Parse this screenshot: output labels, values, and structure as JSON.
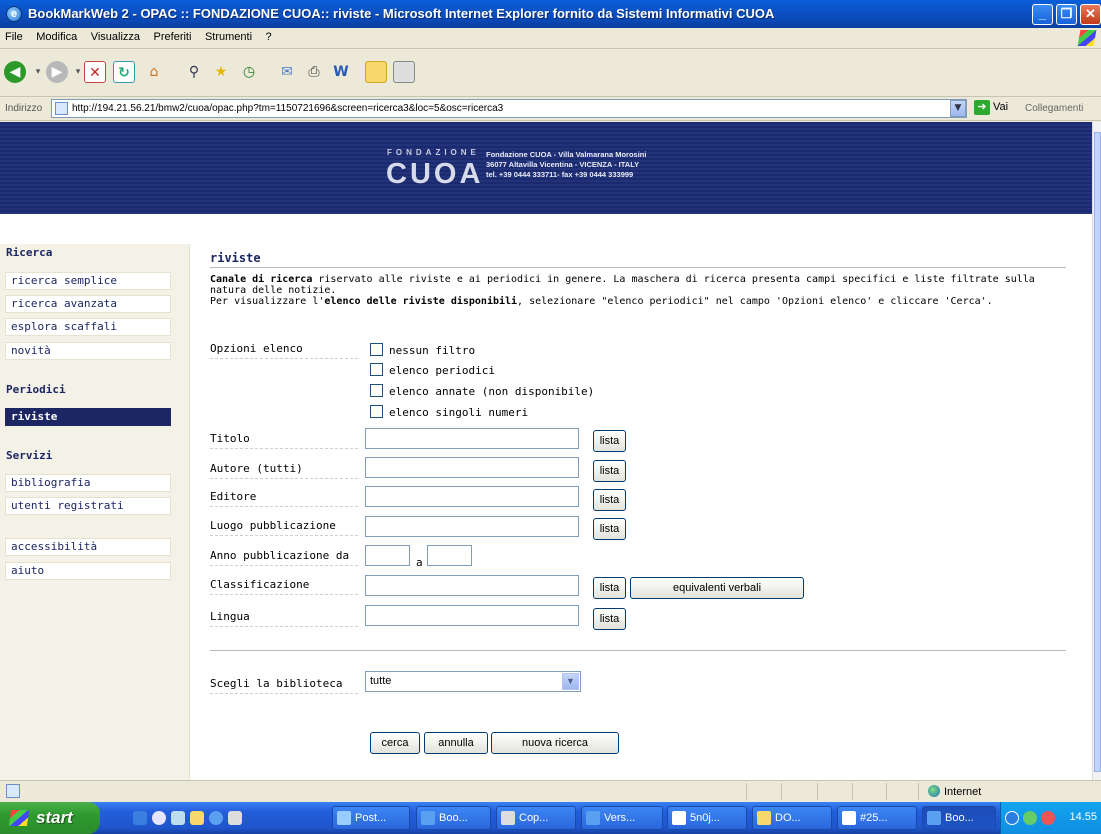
{
  "window": {
    "title": "BookMarkWeb 2 - OPAC :: FONDAZIONE CUOA:: riviste - Microsoft Internet Explorer fornito da Sistemi Informativi CUOA"
  },
  "menu": [
    "File",
    "Modifica",
    "Visualizza",
    "Preferiti",
    "Strumenti",
    "?"
  ],
  "address": {
    "label": "Indirizzo",
    "url": "http://194.21.56.21/bmw2/cuoa/opac.php?tm=1150721696&screen=ricerca3&loc=5&osc=ricerca3",
    "go": "Vai",
    "links": "Collegamenti"
  },
  "banner": {
    "fondazione": "FONDAZIONE",
    "cuoa": "CUOA",
    "line1": "Fondazione CUOA - Villa Valmarana Morosini",
    "line2": "36077 Altavilla Vicentina - VICENZA - ITALY",
    "line3": "tel. +39 0444 333711- fax +39 0444 333999"
  },
  "sidebar": {
    "ricerca_head": "Ricerca",
    "ricerca_items": [
      "ricerca semplice",
      "ricerca avanzata",
      "esplora scaffali",
      "novità"
    ],
    "periodici_head": "Periodici",
    "periodici_items": [
      "riviste"
    ],
    "servizi_head": "Servizi",
    "servizi_items": [
      "bibliografia",
      "utenti registrati"
    ],
    "extra_items": [
      "accessibilità",
      "aiuto"
    ]
  },
  "main": {
    "title": "riviste",
    "intro_bold1": "Canale di ricerca",
    "intro_text1": " riservato alle riviste e ai periodici in genere. La maschera di ricerca presenta campi specifici e liste filtrate sulla natura delle notizie.",
    "intro_text2": "Per visualizzare l'",
    "intro_bold2": "elenco delle riviste disponibili",
    "intro_text3": ", selezionare \"elenco periodici\" nel campo 'Opzioni elenco' e cliccare 'Cerca'.",
    "opzioni_label": "Opzioni elenco",
    "options": [
      "nessun filtro",
      "elenco periodici",
      "elenco annate (non disponibile)",
      "elenco singoli numeri"
    ],
    "fields": {
      "titolo": "Titolo",
      "autore": "Autore (tutti)",
      "editore": "Editore",
      "luogo": "Luogo pubblicazione",
      "anno": "Anno pubblicazione da",
      "anno_a": "a",
      "classificazione": "Classificazione",
      "lingua": "Lingua"
    },
    "lista": "lista",
    "equivalenti": "equivalenti verbali",
    "biblioteca_label": "Scegli la biblioteca",
    "biblioteca_value": "tutte",
    "cerca": "cerca",
    "annulla": "annulla",
    "nuova": "nuova ricerca"
  },
  "status": {
    "zone": "Internet"
  },
  "taskbar": {
    "start": "start",
    "tasks": [
      "Post...",
      "Boo...",
      "Cop...",
      "Vers...",
      "5n0j...",
      "DO...",
      "#25...",
      "Boo..."
    ],
    "clock": "14.55"
  }
}
